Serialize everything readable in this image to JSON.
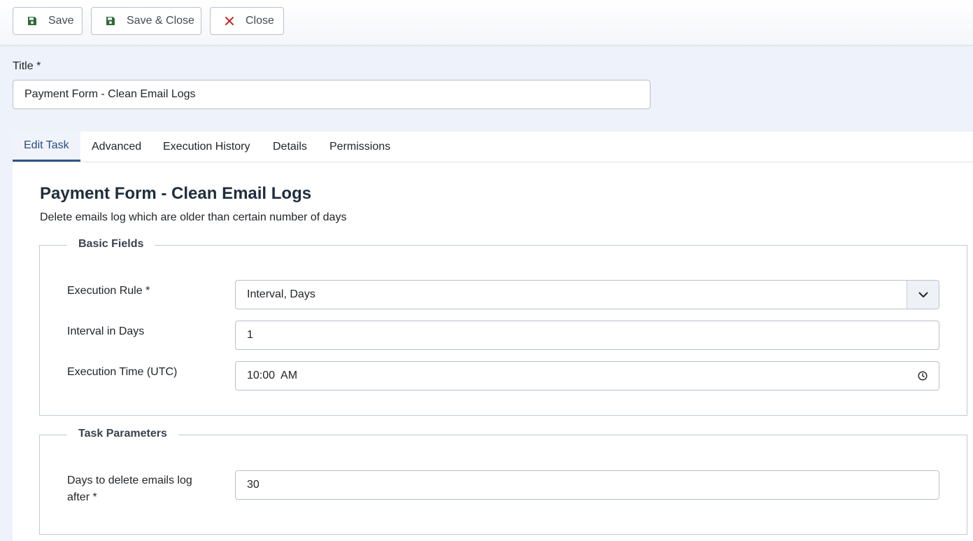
{
  "toolbar": {
    "save_label": "Save",
    "save_close_label": "Save & Close",
    "close_label": "Close"
  },
  "title_field": {
    "label": "Title *",
    "value": "Payment Form - Clean Email Logs"
  },
  "tabs": [
    {
      "label": "Edit Task",
      "active": true
    },
    {
      "label": "Advanced",
      "active": false
    },
    {
      "label": "Execution History",
      "active": false
    },
    {
      "label": "Details",
      "active": false
    },
    {
      "label": "Permissions",
      "active": false
    }
  ],
  "task": {
    "heading": "Payment Form - Clean Email Logs",
    "description": "Delete emails log which are older than certain number of days"
  },
  "basic_fields": {
    "legend": "Basic Fields",
    "execution_rule": {
      "label": "Execution Rule *",
      "value": "Interval, Days"
    },
    "interval_days": {
      "label": "Interval in Days",
      "value": "1"
    },
    "execution_time": {
      "label": "Execution Time (UTC)",
      "value": "10:00  AM"
    }
  },
  "task_parameters": {
    "legend": "Task Parameters",
    "days_to_delete": {
      "label": "Days to delete emails log after *",
      "value": "30"
    }
  },
  "icons": {
    "save": "floppy-disk-icon",
    "close": "close-x-icon",
    "select": "chevron-down-icon",
    "time": "clock-icon"
  },
  "colors": {
    "save_icon": "#2f6b3a",
    "close_icon": "#c52827",
    "active_tab": "#2b4c7b"
  }
}
